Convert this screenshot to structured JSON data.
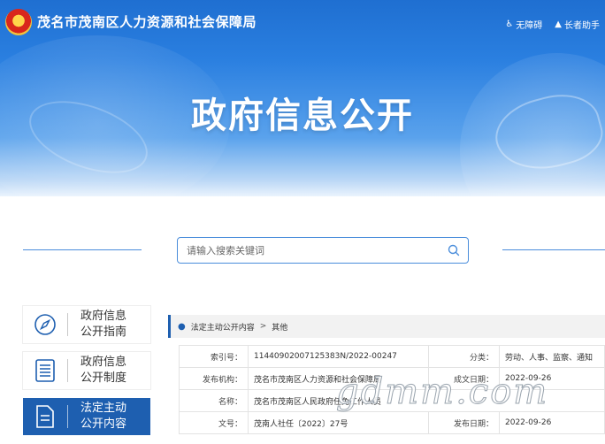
{
  "header": {
    "site_title": "茂名市茂南区人力资源和社会保障局",
    "links": [
      {
        "icon": "accessibility-icon",
        "label": "无障碍"
      },
      {
        "icon": "elder-mode-icon",
        "label": "长者助手"
      }
    ]
  },
  "hero": {
    "title": "政府信息公开"
  },
  "search": {
    "placeholder": "请输入搜索关键词"
  },
  "sidebar": {
    "items": [
      {
        "icon": "compass-icon",
        "label": "政府信息\n公开指南",
        "active": false
      },
      {
        "icon": "list-document-icon",
        "label": "政府信息\n公开制度",
        "active": false
      },
      {
        "icon": "document-icon",
        "label": "法定主动\n公开内容",
        "active": true
      }
    ]
  },
  "breadcrumb": {
    "items": [
      "法定主动公开内容",
      "其他"
    ],
    "separator": ">"
  },
  "meta": {
    "rows": [
      {
        "k1": "索引号：",
        "v1": "11440902007125383N/2022-00247",
        "k2": "分类：",
        "v2": "劳动、人事、监察、通知"
      },
      {
        "k1": "发布机构：",
        "v1": "茂名市茂南区人力资源和社会保障局",
        "k2": "成文日期：",
        "v2": "2022-09-26"
      },
      {
        "k1": "名称：",
        "v1": "茂名市茂南区人民政府任免工作人员",
        "k2": "",
        "v2": ""
      },
      {
        "k1": "文号：",
        "v1": "茂南人社任〔2022〕27号",
        "k2": "发布日期：",
        "v2": "2022-09-26"
      }
    ]
  },
  "watermark": "gdmm.com",
  "colors": {
    "primary": "#1e5fb0",
    "banner": "#2a7fe0",
    "search_border": "#4a8ddb"
  }
}
